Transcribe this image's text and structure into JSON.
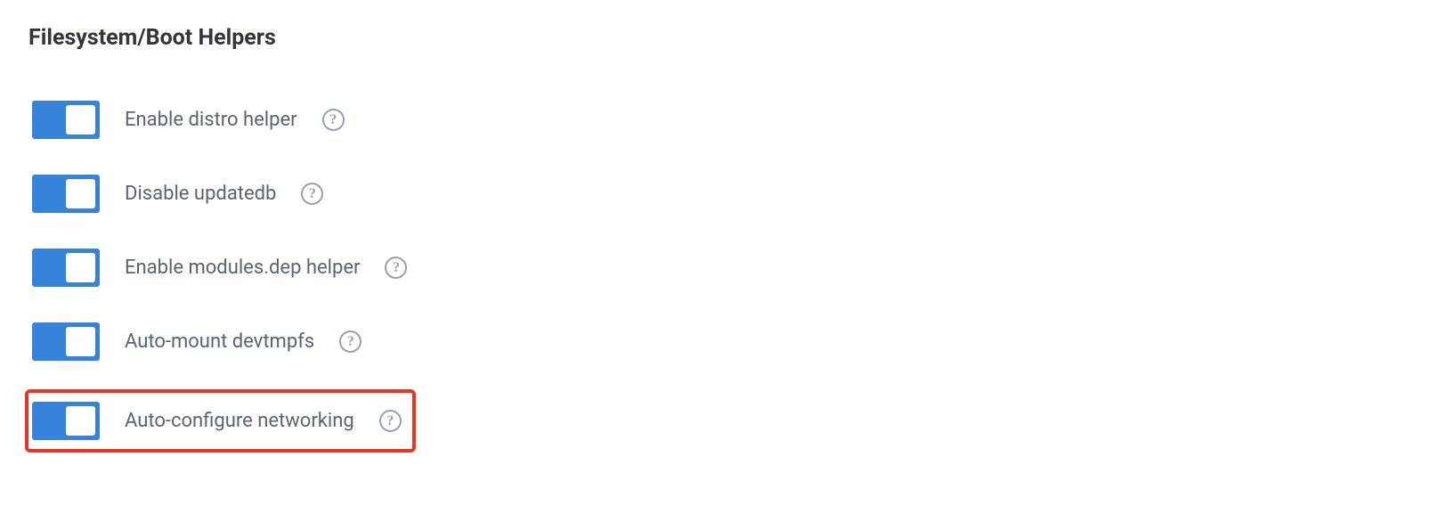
{
  "section": {
    "title": "Filesystem/Boot Helpers"
  },
  "helpers": [
    {
      "label": "Enable distro helper",
      "enabled": true,
      "highlighted": false
    },
    {
      "label": "Disable updatedb",
      "enabled": true,
      "highlighted": false
    },
    {
      "label": "Enable modules.dep helper",
      "enabled": true,
      "highlighted": false
    },
    {
      "label": "Auto-mount devtmpfs",
      "enabled": true,
      "highlighted": false
    },
    {
      "label": "Auto-configure networking",
      "enabled": true,
      "highlighted": true
    }
  ],
  "help_glyph": "?"
}
